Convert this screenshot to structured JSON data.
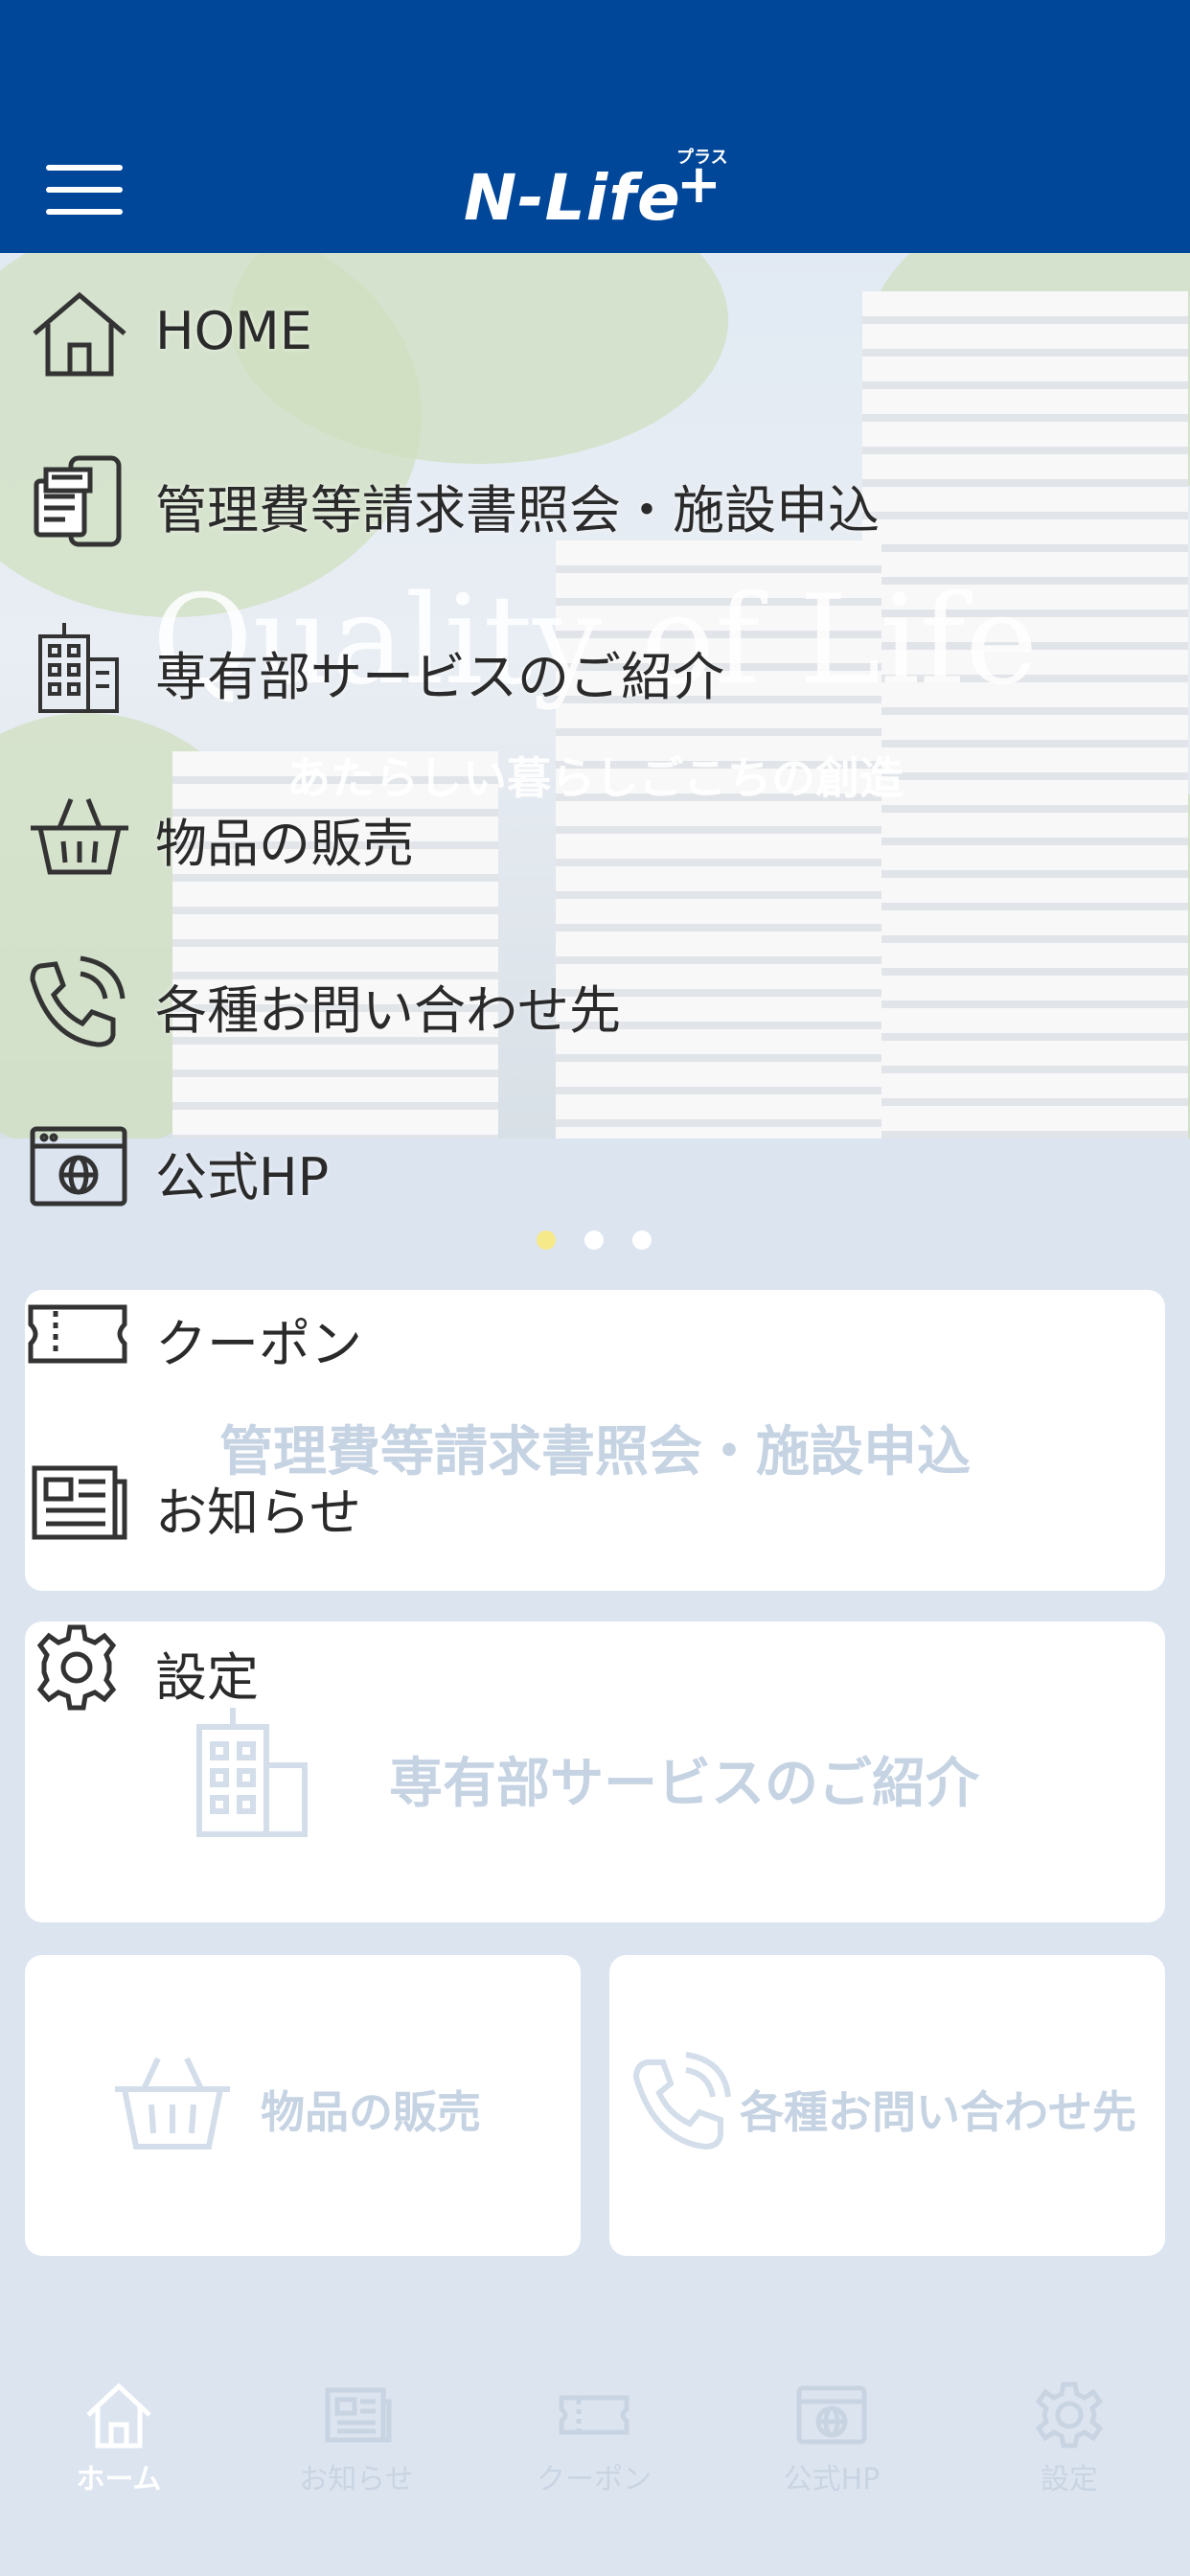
{
  "header": {
    "logo_text": "N-Life",
    "logo_plus": "+",
    "logo_kana": "プラス",
    "background": "#00479a"
  },
  "hero": {
    "title": "Quality of Life",
    "subtitle": "あたらしい暮らしごこちの創造",
    "pager": {
      "count": 3,
      "active_index": 0
    }
  },
  "cards": {
    "invoice": {
      "label": "管理費等請求書照会・施設申込"
    },
    "services": {
      "label": "専有部サービスのご紹介",
      "icon": "building-icon"
    },
    "shop": {
      "label": "物品の販売",
      "icon": "basket-icon"
    },
    "contact": {
      "label": "各種お問い合わせ先",
      "icon": "phone-icon"
    }
  },
  "menu": {
    "items": [
      {
        "label": "HOME",
        "icon": "home-icon"
      },
      {
        "label": "管理費等請求書照会・施設申込",
        "icon": "invoice-icon"
      },
      {
        "label": "専有部サービスのご紹介",
        "icon": "building-icon"
      },
      {
        "label": "物品の販売",
        "icon": "basket-icon"
      },
      {
        "label": "各種お問い合わせ先",
        "icon": "phone-icon"
      },
      {
        "label": "公式HP",
        "icon": "browser-icon"
      },
      {
        "label": "クーポン",
        "icon": "ticket-icon"
      },
      {
        "label": "お知らせ",
        "icon": "newspaper-icon"
      },
      {
        "label": "設定",
        "icon": "gear-icon"
      }
    ]
  },
  "tabbar": {
    "items": [
      {
        "label": "ホーム",
        "icon": "home-icon",
        "active": true
      },
      {
        "label": "お知らせ",
        "icon": "newspaper-icon",
        "active": false
      },
      {
        "label": "クーポン",
        "icon": "ticket-icon",
        "active": false
      },
      {
        "label": "公式HP",
        "icon": "browser-icon",
        "active": false
      },
      {
        "label": "設定",
        "icon": "gear-icon",
        "active": false
      }
    ]
  },
  "colors": {
    "brand": "#00479a",
    "page_bg": "#dce4f0",
    "faded_label": "#c6d3e3",
    "pager_active": "#f5e98a"
  }
}
